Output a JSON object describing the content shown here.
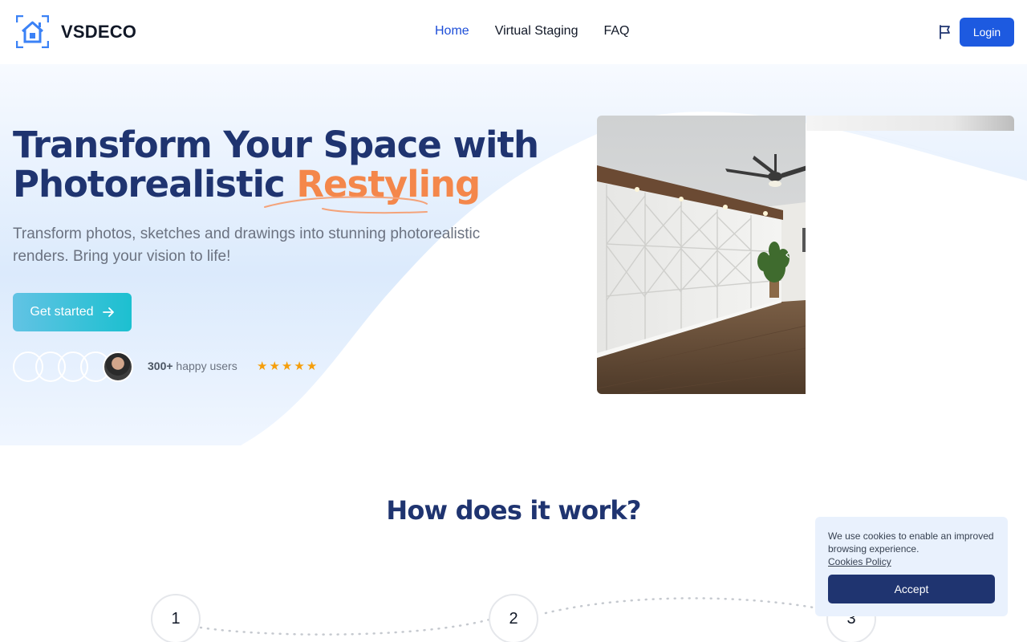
{
  "header": {
    "brand": "VSDECO",
    "nav": [
      {
        "label": "Home",
        "active": true
      },
      {
        "label": "Virtual Staging",
        "active": false
      },
      {
        "label": "FAQ",
        "active": false
      }
    ],
    "language_icon": "flag-icon",
    "login_label": "Login"
  },
  "hero": {
    "title_line1": "Transform Your Space with",
    "title_line2_prefix": "Photorealistic ",
    "title_accent": "Restyling",
    "subtitle": "Transform photos, sketches and drawings into stunning photorealistic renders. Bring your vision to life!",
    "cta_label": "Get started",
    "cta_icon": "arrow-right-icon",
    "users_count": "300+",
    "users_label": " happy users",
    "rating_stars": 5,
    "star_glyph": "★"
  },
  "how": {
    "title": "How does it work?",
    "steps": [
      "1",
      "2",
      "3"
    ]
  },
  "cookie": {
    "text": "We use cookies to enable an improved browsing experience.",
    "link": "Cookies Policy",
    "accept_label": "Accept"
  },
  "colors": {
    "primary": "#1d5ae0",
    "heading": "#1f3470",
    "accent": "#f4874b",
    "cta_start": "#62c3e4",
    "cta_end": "#1cc0d0",
    "star": "#f59e0b"
  }
}
